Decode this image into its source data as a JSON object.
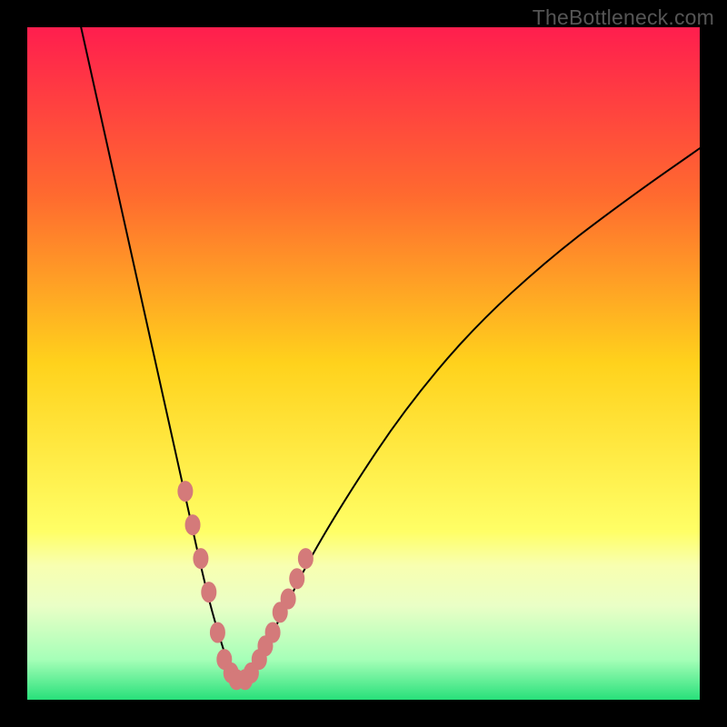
{
  "watermark": "TheBottleneck.com",
  "chart_data": {
    "type": "line",
    "title": "",
    "xlabel": "",
    "ylabel": "",
    "xlim": [
      0,
      100
    ],
    "ylim": [
      0,
      100
    ],
    "axes_visible": false,
    "grid": false,
    "legend": false,
    "background_gradient_stops": [
      {
        "offset": 0.0,
        "color": "#ff1e4e"
      },
      {
        "offset": 0.25,
        "color": "#ff6a2f"
      },
      {
        "offset": 0.5,
        "color": "#ffd21c"
      },
      {
        "offset": 0.75,
        "color": "#ffff66"
      },
      {
        "offset": 0.8,
        "color": "#f8ffb0"
      },
      {
        "offset": 0.86,
        "color": "#eaffc6"
      },
      {
        "offset": 0.94,
        "color": "#a6ffb8"
      },
      {
        "offset": 1.0,
        "color": "#28e07a"
      }
    ],
    "series": [
      {
        "name": "curve",
        "x": [
          8,
          12,
          16,
          20,
          22,
          24,
          26,
          27.5,
          29,
          30,
          31,
          32,
          33,
          35,
          38,
          42,
          48,
          56,
          66,
          78,
          90,
          100
        ],
        "values": [
          100,
          82,
          64,
          46,
          37,
          28,
          19,
          13,
          8,
          5,
          3,
          3,
          4,
          7,
          13,
          21,
          31,
          43,
          55,
          66,
          75,
          82
        ]
      }
    ],
    "markers": {
      "name": "dots",
      "x": [
        23.5,
        24.6,
        25.8,
        27.0,
        28.3,
        29.3,
        30.3,
        31.1,
        32.4,
        33.3,
        34.5,
        35.4,
        36.5,
        37.6,
        38.8,
        40.1,
        41.4
      ],
      "values": [
        31,
        26,
        21,
        16,
        10,
        6,
        4,
        3,
        3,
        4,
        6,
        8,
        10,
        13,
        15,
        18,
        21
      ]
    }
  }
}
